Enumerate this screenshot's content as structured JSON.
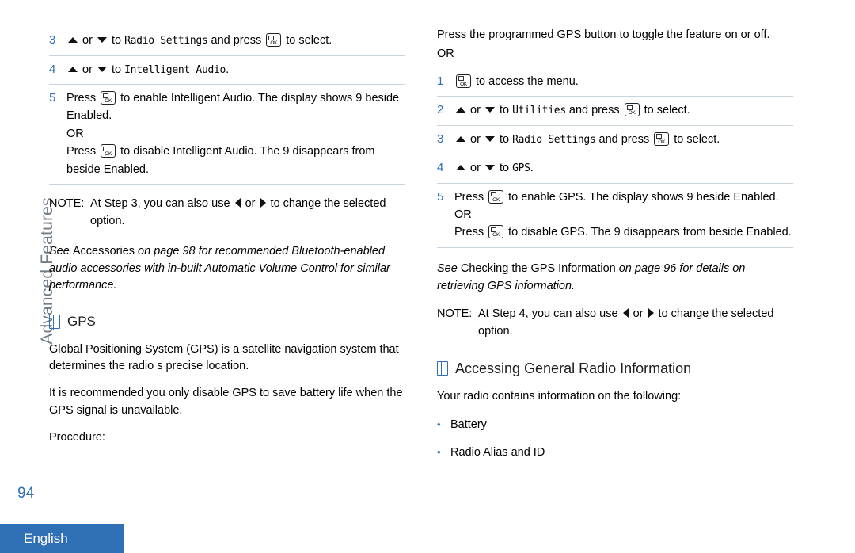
{
  "sidebar": {
    "section_label": "Advanced Features",
    "page_number": "94",
    "language_tab": "English"
  },
  "left_column": {
    "steps": [
      {
        "num": "3",
        "parts": [
          {
            "t": "icon",
            "v": "arrow-up-icon"
          },
          {
            "t": "text",
            "v": " or "
          },
          {
            "t": "icon",
            "v": "arrow-down-icon"
          },
          {
            "t": "text",
            "v": " to "
          },
          {
            "t": "mono",
            "v": "Radio Settings"
          },
          {
            "t": "text",
            "v": " and press "
          },
          {
            "t": "icon",
            "v": "menu-ok-key-icon"
          },
          {
            "t": "text",
            "v": " to select."
          }
        ]
      },
      {
        "num": "4",
        "parts": [
          {
            "t": "icon",
            "v": "arrow-up-icon"
          },
          {
            "t": "text",
            "v": " or "
          },
          {
            "t": "icon",
            "v": "arrow-down-icon"
          },
          {
            "t": "text",
            "v": " to "
          },
          {
            "t": "mono",
            "v": "Intelligent Audio"
          },
          {
            "t": "text",
            "v": "."
          }
        ]
      },
      {
        "num": "5",
        "parts": [
          {
            "t": "text",
            "v": "Press "
          },
          {
            "t": "icon",
            "v": "menu-ok-key-icon"
          },
          {
            "t": "text",
            "v": " to enable Intelligent Audio. The display shows  9 beside Enabled."
          },
          {
            "t": "br"
          },
          {
            "t": "text",
            "v": "OR"
          },
          {
            "t": "br"
          },
          {
            "t": "text",
            "v": "Press "
          },
          {
            "t": "icon",
            "v": "menu-ok-key-icon"
          },
          {
            "t": "text",
            "v": " to disable Intelligent Audio. The  9 disappears from beside Enabled."
          }
        ]
      }
    ],
    "note": {
      "label": "NOTE:",
      "parts": [
        {
          "t": "text",
          "v": "At Step 3, you can also use "
        },
        {
          "t": "icon",
          "v": "arrow-left-icon"
        },
        {
          "t": "text",
          "v": " or "
        },
        {
          "t": "icon",
          "v": "arrow-right-icon"
        },
        {
          "t": "text",
          "v": " to change the selected option."
        }
      ]
    },
    "xref": {
      "lead": "See",
      "roman": "Accessories",
      "tail": "on page 98 for recommended Bluetooth-enabled audio accessories with in-built Automatic Volume Control for similar performance."
    },
    "gps_heading": "GPS",
    "paragraphs": [
      "Global Positioning System (GPS) is a satellite navigation system that determines the radio s precise location.",
      "It is recommended you only disable GPS to save battery life when the GPS signal is unavailable.",
      "Procedure:"
    ]
  },
  "right_column": {
    "intro": "Press the programmed GPS button to toggle the feature on or off.",
    "or": "OR",
    "steps": [
      {
        "num": "1",
        "parts": [
          {
            "t": "icon",
            "v": "menu-ok-key-icon"
          },
          {
            "t": "text",
            "v": " to access the menu."
          }
        ]
      },
      {
        "num": "2",
        "parts": [
          {
            "t": "icon",
            "v": "arrow-up-icon"
          },
          {
            "t": "text",
            "v": " or "
          },
          {
            "t": "icon",
            "v": "arrow-down-icon"
          },
          {
            "t": "text",
            "v": " to "
          },
          {
            "t": "mono",
            "v": "Utilities"
          },
          {
            "t": "text",
            "v": " and press "
          },
          {
            "t": "icon",
            "v": "menu-ok-key-icon"
          },
          {
            "t": "text",
            "v": " to select."
          }
        ]
      },
      {
        "num": "3",
        "parts": [
          {
            "t": "icon",
            "v": "arrow-up-icon"
          },
          {
            "t": "text",
            "v": " or "
          },
          {
            "t": "icon",
            "v": "arrow-down-icon"
          },
          {
            "t": "text",
            "v": " to "
          },
          {
            "t": "mono",
            "v": "Radio Settings"
          },
          {
            "t": "text",
            "v": " and press "
          },
          {
            "t": "icon",
            "v": "menu-ok-key-icon"
          },
          {
            "t": "text",
            "v": " to select."
          }
        ]
      },
      {
        "num": "4",
        "parts": [
          {
            "t": "icon",
            "v": "arrow-up-icon"
          },
          {
            "t": "text",
            "v": " or "
          },
          {
            "t": "icon",
            "v": "arrow-down-icon"
          },
          {
            "t": "text",
            "v": " to "
          },
          {
            "t": "mono",
            "v": "GPS"
          },
          {
            "t": "text",
            "v": "."
          }
        ]
      },
      {
        "num": "5",
        "parts": [
          {
            "t": "text",
            "v": "Press "
          },
          {
            "t": "icon",
            "v": "menu-ok-key-icon"
          },
          {
            "t": "text",
            "v": " to enable GPS. The display shows  9 beside Enabled."
          },
          {
            "t": "br"
          },
          {
            "t": "text",
            "v": "OR"
          },
          {
            "t": "br"
          },
          {
            "t": "text",
            "v": "Press "
          },
          {
            "t": "icon",
            "v": "menu-ok-key-icon"
          },
          {
            "t": "text",
            "v": " to disable GPS. The  9 disappears from beside Enabled."
          }
        ]
      }
    ],
    "xref": {
      "lead": "See",
      "roman": "Checking the GPS Information",
      "tail": "on page 96 for details on retrieving GPS information."
    },
    "note": {
      "label": "NOTE:",
      "parts": [
        {
          "t": "text",
          "v": "At Step 4, you can also use "
        },
        {
          "t": "icon",
          "v": "arrow-left-icon"
        },
        {
          "t": "text",
          "v": " or "
        },
        {
          "t": "icon",
          "v": "arrow-right-icon"
        },
        {
          "t": "text",
          "v": " to change the selected option."
        }
      ]
    },
    "section_heading": "Accessing General Radio Information",
    "section_intro": "Your radio contains information on the following:",
    "bullets": [
      "Battery",
      "Radio Alias and ID"
    ],
    "bullet_glyph": "•"
  },
  "colors": {
    "accent": "#2f6fb5",
    "rule": "#c9d4de",
    "sidebar_text": "#6f7b86"
  }
}
